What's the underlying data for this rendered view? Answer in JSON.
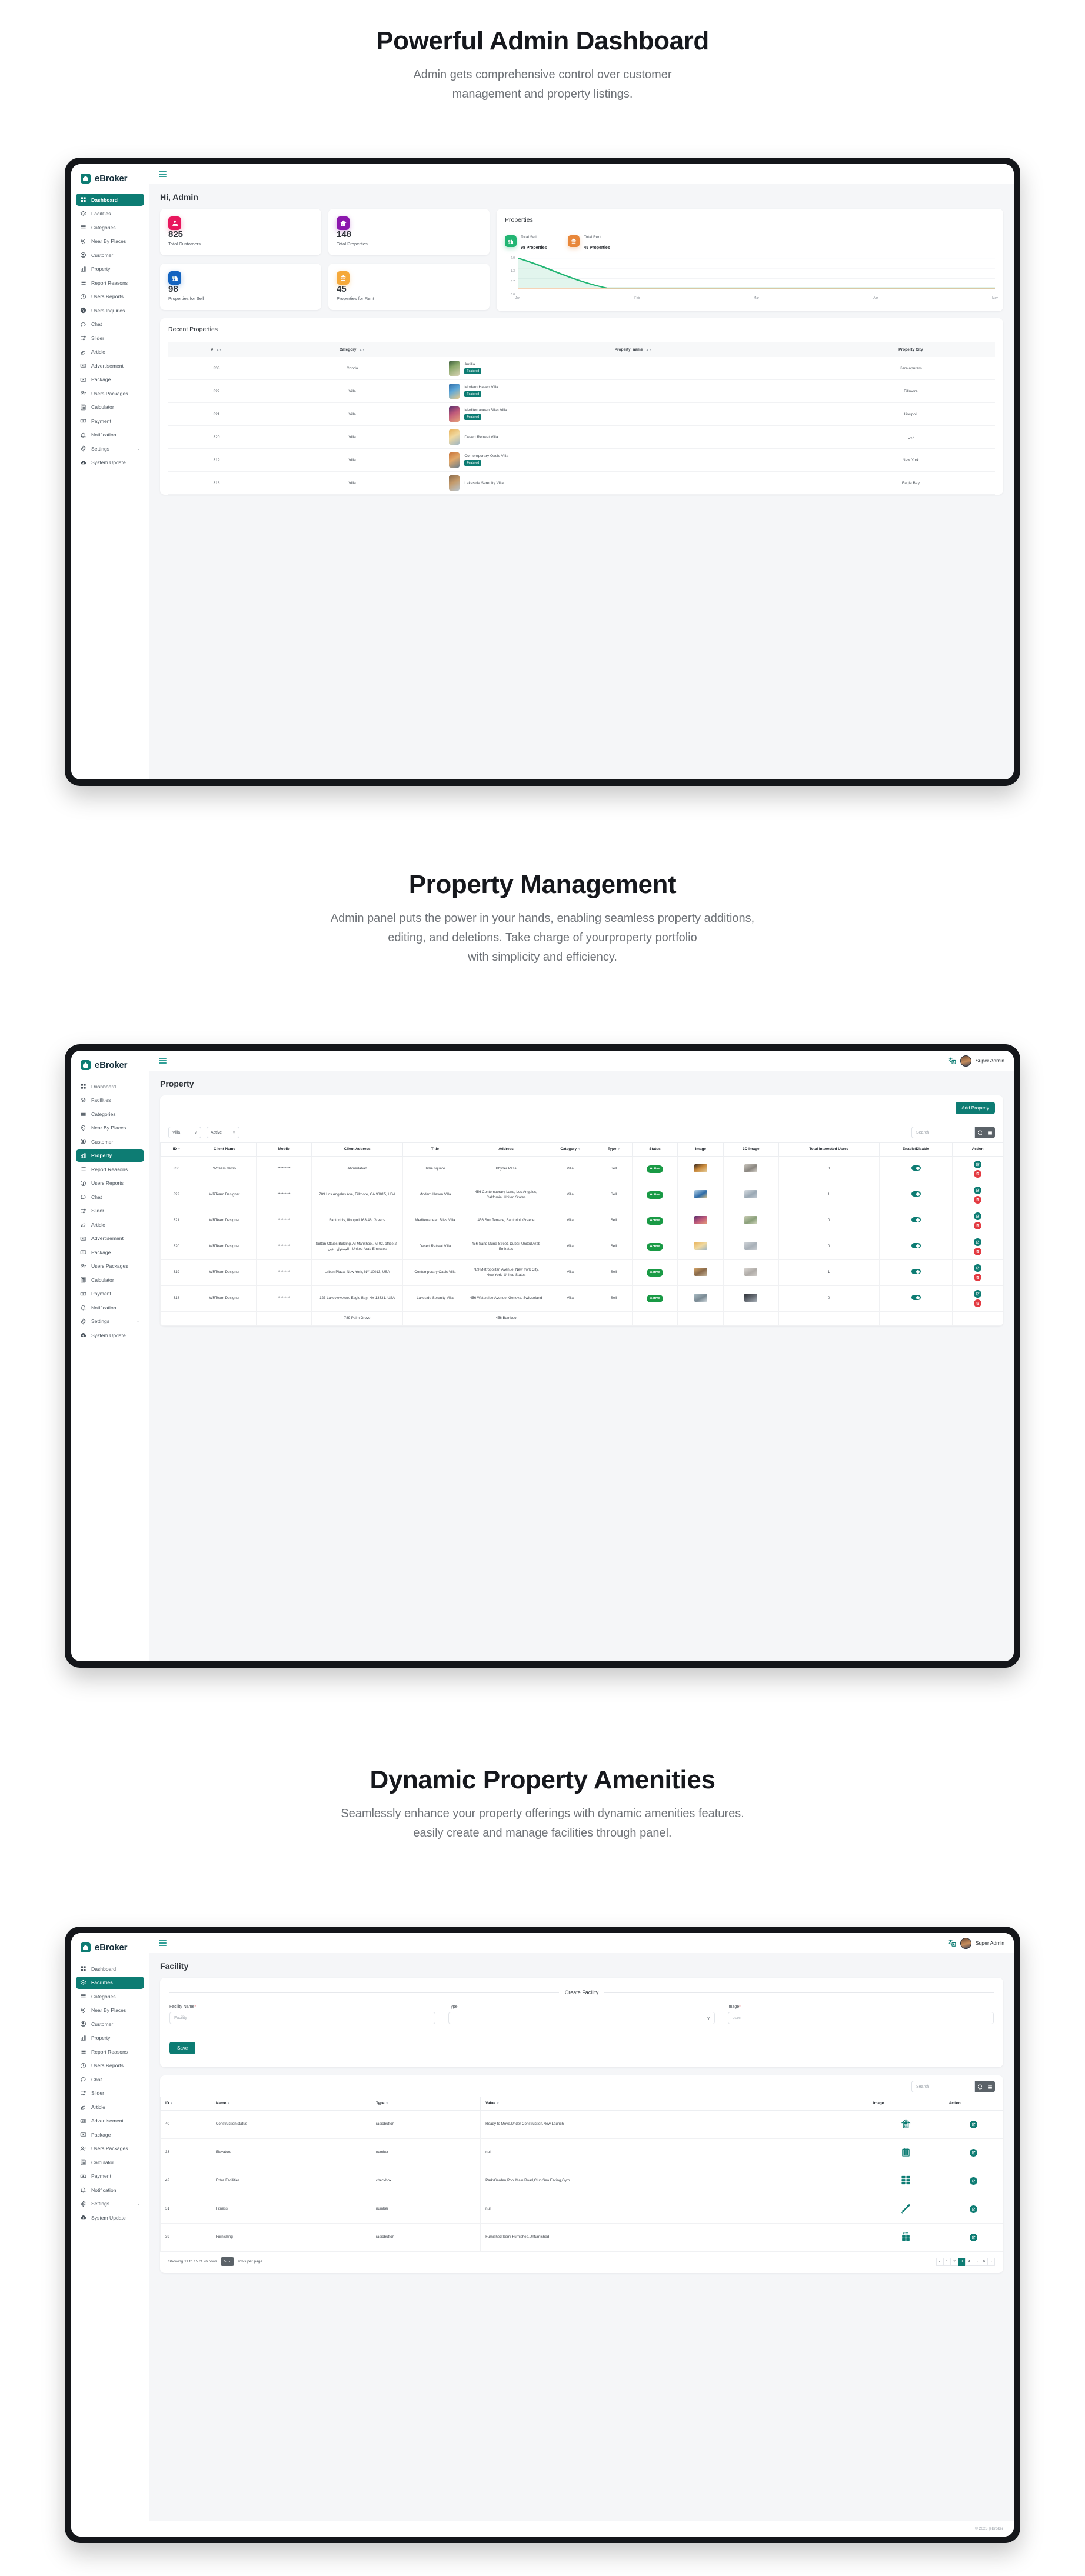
{
  "brand": {
    "name": "eBroker"
  },
  "sections": [
    {
      "title": "Powerful Admin Dashboard",
      "subtitle_line1": "Admin gets comprehensive control over customer",
      "subtitle_line2": "management and property listings."
    },
    {
      "title": "Property Management",
      "subtitle_line1": "Admin panel puts the power in your hands, enabling seamless property additions,",
      "subtitle_line2": "editing, and deletions. Take charge of yourproperty portfolio",
      "subtitle_line3": "with simplicity and efficiency."
    },
    {
      "title": "Dynamic Property Amenities",
      "subtitle_line1": "Seamlessly enhance your property offerings with dynamic amenities features.",
      "subtitle_line2": "easily create and manage facilities through panel."
    }
  ],
  "sidebar_dashboard": {
    "items": [
      {
        "label": "Dashboard",
        "icon": "grid-icon",
        "active": true
      },
      {
        "label": "Facilities",
        "icon": "layers-icon",
        "active": false
      },
      {
        "label": "Categories",
        "icon": "list-icon",
        "active": false
      },
      {
        "label": "Near By Places",
        "icon": "map-pin-icon",
        "active": false
      },
      {
        "label": "Customer",
        "icon": "user-circle-icon",
        "active": false
      },
      {
        "label": "Property",
        "icon": "building-icon",
        "active": false
      },
      {
        "label": "Report Reasons",
        "icon": "list-bullet-icon",
        "active": false
      },
      {
        "label": "Users Reports",
        "icon": "alert-circle-icon",
        "active": false
      },
      {
        "label": "Users Inquiries",
        "icon": "question-circle-icon",
        "active": false
      },
      {
        "label": "Chat",
        "icon": "chat-bubble-icon",
        "active": false
      },
      {
        "label": "Slider",
        "icon": "sliders-icon",
        "active": false
      },
      {
        "label": "Article",
        "icon": "pen-icon",
        "active": false
      },
      {
        "label": "Advertisement",
        "icon": "ad-icon",
        "active": false
      },
      {
        "label": "Package",
        "icon": "package-icon",
        "active": false
      },
      {
        "label": "Users Packages",
        "icon": "user-check-icon",
        "active": false
      },
      {
        "label": "Calculator",
        "icon": "calculator-icon",
        "active": false
      },
      {
        "label": "Payment",
        "icon": "card-icon",
        "active": false
      },
      {
        "label": "Notification",
        "icon": "bell-icon",
        "active": false
      },
      {
        "label": "Settings",
        "icon": "gear-icon",
        "active": false,
        "chevron": "⌄"
      },
      {
        "label": "System Update",
        "icon": "cloud-download-icon",
        "active": false
      }
    ]
  },
  "sidebar_property": {
    "items": [
      {
        "label": "Dashboard",
        "icon": "grid-icon",
        "active": false
      },
      {
        "label": "Facilities",
        "icon": "layers-icon",
        "active": false
      },
      {
        "label": "Categories",
        "icon": "list-icon",
        "active": false
      },
      {
        "label": "Near By Places",
        "icon": "map-pin-icon",
        "active": false
      },
      {
        "label": "Customer",
        "icon": "user-circle-icon",
        "active": false
      },
      {
        "label": "Property",
        "icon": "building-icon",
        "active": true
      },
      {
        "label": "Report Reasons",
        "icon": "list-bullet-icon",
        "active": false
      },
      {
        "label": "Users Reports",
        "icon": "alert-circle-icon",
        "active": false
      },
      {
        "label": "Chat",
        "icon": "chat-bubble-icon",
        "active": false
      },
      {
        "label": "Slider",
        "icon": "sliders-icon",
        "active": false
      },
      {
        "label": "Article",
        "icon": "pen-icon",
        "active": false
      },
      {
        "label": "Advertisement",
        "icon": "ad-icon",
        "active": false
      },
      {
        "label": "Package",
        "icon": "package-icon",
        "active": false
      },
      {
        "label": "Users Packages",
        "icon": "user-check-icon",
        "active": false
      },
      {
        "label": "Calculator",
        "icon": "calculator-icon",
        "active": false
      },
      {
        "label": "Payment",
        "icon": "card-icon",
        "active": false
      },
      {
        "label": "Notification",
        "icon": "bell-icon",
        "active": false
      },
      {
        "label": "Settings",
        "icon": "gear-icon",
        "active": false,
        "chevron": "⌄"
      },
      {
        "label": "System Update",
        "icon": "cloud-download-icon",
        "active": false
      }
    ]
  },
  "sidebar_facility": {
    "items": [
      {
        "label": "Dashboard",
        "icon": "grid-icon",
        "active": false
      },
      {
        "label": "Facilities",
        "icon": "layers-icon",
        "active": true
      },
      {
        "label": "Categories",
        "icon": "list-icon",
        "active": false
      },
      {
        "label": "Near By Places",
        "icon": "map-pin-icon",
        "active": false
      },
      {
        "label": "Customer",
        "icon": "user-circle-icon",
        "active": false
      },
      {
        "label": "Property",
        "icon": "building-icon",
        "active": false
      },
      {
        "label": "Report Reasons",
        "icon": "list-bullet-icon",
        "active": false
      },
      {
        "label": "Users Reports",
        "icon": "alert-circle-icon",
        "active": false
      },
      {
        "label": "Chat",
        "icon": "chat-bubble-icon",
        "active": false
      },
      {
        "label": "Slider",
        "icon": "sliders-icon",
        "active": false
      },
      {
        "label": "Article",
        "icon": "pen-icon",
        "active": false
      },
      {
        "label": "Advertisement",
        "icon": "ad-icon",
        "active": false
      },
      {
        "label": "Package",
        "icon": "package-icon",
        "active": false
      },
      {
        "label": "Users Packages",
        "icon": "user-check-icon",
        "active": false
      },
      {
        "label": "Calculator",
        "icon": "calculator-icon",
        "active": false
      },
      {
        "label": "Payment",
        "icon": "card-icon",
        "active": false
      },
      {
        "label": "Notification",
        "icon": "bell-icon",
        "active": false
      },
      {
        "label": "Settings",
        "icon": "gear-icon",
        "active": false,
        "chevron": "⌄"
      },
      {
        "label": "System Update",
        "icon": "cloud-download-icon",
        "active": false
      }
    ]
  },
  "dashboard": {
    "greeting": "Hi, Admin",
    "stats": [
      {
        "value": "825",
        "label": "Total Customers",
        "color": "#e8175d",
        "icon": "user-badge-icon"
      },
      {
        "value": "148",
        "label": "Total Properties",
        "color": "#8c18ad",
        "icon": "home-icon"
      },
      {
        "value": "98",
        "label": "Properties for Sell",
        "color": "#1464c0",
        "icon": "sale-sign-icon"
      },
      {
        "value": "45",
        "label": "Properties for Rent",
        "color": "#f5a93b",
        "icon": "rent-sign-icon"
      }
    ],
    "chart_card_title": "Properties",
    "legend": [
      {
        "title": "Total Sell",
        "value": "98 Properties",
        "color": "#22b573",
        "icon": "sale-sign-icon"
      },
      {
        "title": "Total Rent",
        "value": "45 Properties",
        "color": "#e8873a",
        "icon": "rent-sign-icon"
      }
    ],
    "recent_title": "Recent Properties",
    "recent_columns": [
      "#",
      "Category",
      "Property_name",
      "Property City"
    ],
    "recent_rows": [
      {
        "id": "333",
        "category": "Condo",
        "name": "Antilia",
        "featured": "Featured",
        "city": "Keralapuram",
        "thumb": "linear-gradient(150deg,#3a5a3a,#8aa86a 40%,#d8d2b4)"
      },
      {
        "id": "322",
        "category": "Villa",
        "name": "Modern Haven Villa",
        "featured": "Featured",
        "city": "Fillmore",
        "thumb": "linear-gradient(150deg,#2d6ba8,#5fa8d8 45%,#e6c98a)"
      },
      {
        "id": "321",
        "category": "Villa",
        "name": "Mediterranean Bliss Villa",
        "featured": "Featured",
        "city": "Ilioupoli",
        "thumb": "linear-gradient(150deg,#5b2f6e,#c05a7a 45%,#e6a07a)"
      },
      {
        "id": "320",
        "category": "Villa",
        "name": "Desert Retreat Villa",
        "featured": "",
        "city": "دبي",
        "thumb": "linear-gradient(150deg,#e8b25a,#f0d9a0 45%,#9fb6c4)"
      },
      {
        "id": "319",
        "category": "Villa",
        "name": "Contemporary Oasis Villa",
        "featured": "Featured",
        "city": "New York",
        "thumb": "linear-gradient(150deg,#c8743a,#e0a86a 45%,#6d7f8c)"
      },
      {
        "id": "318",
        "category": "Villa",
        "name": "Lakeside Serenity Villa",
        "featured": "",
        "city": "Eagle Bay",
        "thumb": "linear-gradient(150deg,#8a6a4a,#c49a6a 45%,#b8c4cc)"
      }
    ]
  },
  "chart_data": {
    "type": "area",
    "title": "Properties",
    "x": [
      "Jan",
      "Feb",
      "Mar",
      "Apr",
      "May"
    ],
    "xlabel": "",
    "ylabel": "",
    "ylim": [
      0.0,
      2.0
    ],
    "yticks": [
      0.0,
      0.7,
      1.3,
      2.0
    ],
    "grid": true,
    "legend_position": "top",
    "series": [
      {
        "name": "Total Sell",
        "color": "#22b573",
        "values": [
          2.0,
          0.0,
          0.0,
          0.0,
          0.0
        ]
      },
      {
        "name": "Total Rent",
        "color": "#e8873a",
        "values": [
          0.0,
          0.0,
          0.0,
          0.0,
          0.0
        ]
      }
    ]
  },
  "property_page": {
    "admin_name": "Super Admin",
    "page_title": "Property",
    "add_button": "Add Property",
    "filter_category": "Villa",
    "filter_status": "Active",
    "search_placeholder": "Search",
    "columns": [
      "ID",
      "Client Name",
      "Mobile",
      "Client Address",
      "Title",
      "Address",
      "Category",
      "Type",
      "Status",
      "Image",
      "3D Image",
      "Total Interested Users",
      "Enable/Disable",
      "Action"
    ],
    "rows": [
      {
        "id": "330",
        "client": "Wrteam demo",
        "mobile": "*********",
        "client_address": "Ahmedabad",
        "title": "Time square",
        "address": "Khyber Pass",
        "category": "Villa",
        "type": "Sell",
        "status": "Active",
        "interested": "0",
        "img": "linear-gradient(150deg,#3a2a20,#c8883a 45%,#e8d2a0)",
        "img3d": "linear-gradient(150deg,#c8c4bc,#8a8680 55%,#dcd8d0)"
      },
      {
        "id": "322",
        "client": "WRTeam Designer",
        "mobile": "*********",
        "client_address": "789 Los Angeles Ave, Fillmore, CA 93015, USA",
        "title": "Modern Haven Villa",
        "address": "456 Contemporary Lane, Los Angeles, California, United States",
        "category": "Villa",
        "type": "Sell",
        "status": "Active",
        "interested": "1",
        "img": "linear-gradient(150deg,#bcd6e8,#2d6ba8 55%,#e6c98a)",
        "img3d": "linear-gradient(150deg,#d8dde2,#9aa8b4 55%,#c4ccd4)"
      },
      {
        "id": "321",
        "client": "WRTeam Designer",
        "mobile": "*********",
        "client_address": "Santorinis, Ilioupoli 163 46, Greece",
        "title": "Mediterranean Bliss Villa",
        "address": "456 Sun Terrace, Santorini, Greece",
        "category": "Villa",
        "type": "Sell",
        "status": "Active",
        "interested": "0",
        "img": "linear-gradient(150deg,#5b2f6e,#c05a7a 50%,#e6a07a)",
        "img3d": "linear-gradient(150deg,#c8ccb4,#8aa07a 55%,#d4d8c0)"
      },
      {
        "id": "320",
        "client": "WRTeam Designer",
        "mobile": "*********",
        "client_address": "Sultan Otaibs Bulding, Al Mankhool, M-02, office 2 - المنخول - دبي - United Arab Emirates",
        "title": "Desert Retreat Villa",
        "address": "456 Sand Dune Street, Dubai, United Arab Emirates",
        "category": "Villa",
        "type": "Sell",
        "status": "Active",
        "interested": "0",
        "img": "linear-gradient(150deg,#e8b25a,#f0d9a0 50%,#9fb6c4)",
        "img3d": "linear-gradient(150deg,#d0d4d8,#a8b0b8 55%,#c8ccd0)"
      },
      {
        "id": "319",
        "client": "WRTeam Designer",
        "mobile": "*********",
        "client_address": "Urban Plaza, New York, NY 10013, USA",
        "title": "Contemporary Oasis Villa",
        "address": "789 Metropolitan Avenue, New York City, New York, United States",
        "category": "Villa",
        "type": "Sell",
        "status": "Active",
        "interested": "1",
        "img": "linear-gradient(150deg,#d8a86a,#8a6a4a 50%,#c4b49a)",
        "img3d": "linear-gradient(150deg,#dcd8d4,#b0aca8 55%,#cfcbc7)"
      },
      {
        "id": "318",
        "client": "WRTeam Designer",
        "mobile": "*********",
        "client_address": "123 Lakeview Ave, Eagle Bay, NY 13331, USA",
        "title": "Lakeside Serenity Villa",
        "address": "456 Waterside Avenue, Geneva, Switzerland",
        "category": "Villa",
        "type": "Sell",
        "status": "Active",
        "interested": "0",
        "img": "linear-gradient(150deg,#aabcc4,#7a8a94 55%,#d0d8dc)",
        "img3d": "linear-gradient(150deg,#2a2e34,#6a7078 55%,#a8b0b8)"
      }
    ],
    "partial_row": {
      "client_address": "789 Palm Grove",
      "address": "456 Bamboo"
    }
  },
  "facility_page": {
    "admin_name": "Super Admin",
    "page_title": "Facility",
    "form_title": "Create Facility",
    "field_name_label": "Facility Name",
    "field_name_placeholder": "Facility",
    "field_type_label": "Type",
    "field_image_label": "Image",
    "file_button": "osen",
    "save_button": "Save",
    "search_placeholder": "Search",
    "columns": [
      "ID",
      "Name",
      "Type",
      "Value",
      "Image",
      "Action"
    ],
    "rows": [
      {
        "id": "40",
        "name": "Construction status",
        "type": "radiobutton",
        "value": "Ready to Move,Under Construction,New Launch",
        "icon": "house-construction-icon"
      },
      {
        "id": "33",
        "name": "Elevatore",
        "type": "number",
        "value": "null",
        "icon": "elevator-icon"
      },
      {
        "id": "42",
        "name": "Extra Facilities",
        "type": "checkbox",
        "value": "Park/Garden,Pool,Main Road,Club,Sea Facing,Gym",
        "icon": "amenities-grid-icon"
      },
      {
        "id": "31",
        "name": "Fitness",
        "type": "number",
        "value": "null",
        "icon": "dumbbell-icon"
      },
      {
        "id": "39",
        "name": "Furnishing",
        "type": "radiobutton",
        "value": "Furnished,Semi-Furnished,Unfurnished",
        "icon": "furniture-icon"
      }
    ],
    "showing_text": "Showing 11 to 15 of 26 rows",
    "rows_per_page": "5",
    "rows_per_page_suffix": "rows per page",
    "pages": [
      "‹",
      "1",
      "2",
      "3",
      "4",
      "5",
      "6",
      "›"
    ],
    "active_page": "3",
    "copyright": "© 2023 |eBroker"
  }
}
